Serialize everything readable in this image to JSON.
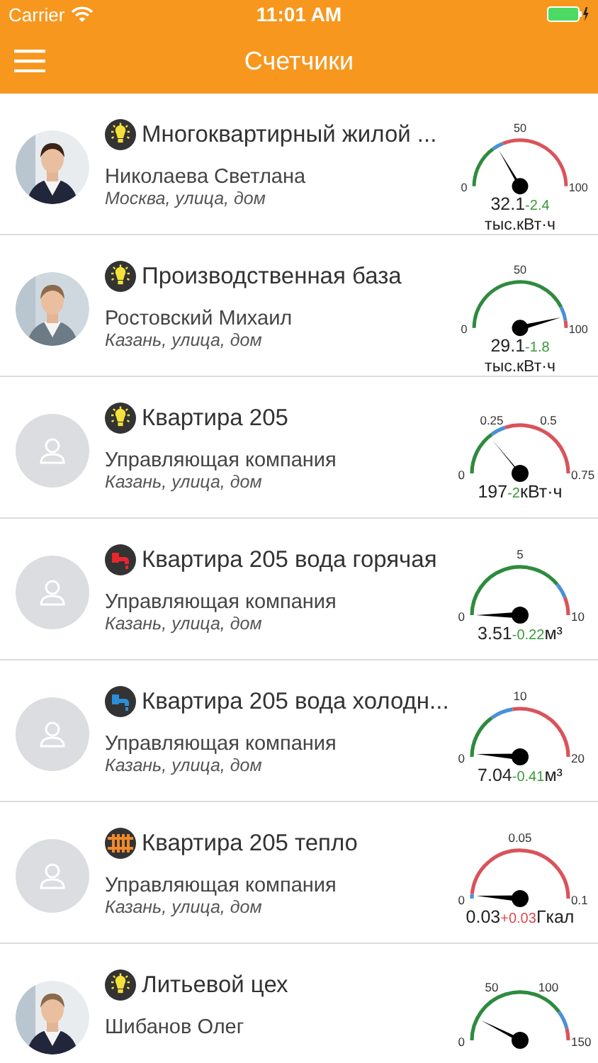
{
  "status_bar": {
    "carrier": "Carrier",
    "time": "11:01 AM"
  },
  "nav_bar": {
    "title": "Счетчики"
  },
  "meters": [
    {
      "icon": {
        "kind": "electricity"
      },
      "title": "Многоквартирный жилой ...",
      "owner": "Николаева Светлана",
      "address": "Москва, улица, дом",
      "gauge": {
        "ticks": [
          "0",
          "50",
          "100"
        ],
        "zones": [
          {
            "color": "#2e8b3e"
          },
          {
            "color": "#4a90d9"
          },
          {
            "color": "#d9535b"
          }
        ],
        "value": "32.1",
        "delta": {
          "text": "-2.4",
          "kind": "decrease"
        },
        "unit": "тыс.кВт·ч",
        "unit_on_new_line": true
      }
    },
    {
      "icon": {
        "kind": "electricity"
      },
      "title": "Производственная база",
      "owner": "Ростовский Михаил",
      "address": "Казань, улица, дом",
      "gauge": {
        "ticks": [
          "0",
          "50",
          "100"
        ],
        "zones": [
          {
            "color": "#2e8b3e"
          },
          {
            "color": "#4a90d9"
          },
          {
            "color": "#d9535b"
          }
        ],
        "value": "29.1",
        "delta": {
          "text": "-1.8",
          "kind": "decrease"
        },
        "unit": "тыс.кВт·ч",
        "unit_on_new_line": true
      }
    },
    {
      "avatar": {
        "kind": "placeholder"
      },
      "icon": {
        "kind": "electricity"
      },
      "title": "Квартира 205",
      "owner": "Управляющая компания",
      "address": "Казань, улица, дом",
      "gauge": {
        "ticks": [
          "0",
          "0.25",
          "0.5",
          "0.75"
        ],
        "zones": [
          {
            "color": "#2e8b3e"
          },
          {
            "color": "#4a90d9"
          },
          {
            "color": "#d9535b"
          }
        ],
        "value": "197",
        "delta": {
          "text": "-2",
          "kind": "decrease"
        },
        "unit": "кВт·ч",
        "unit_on_new_line": false
      }
    },
    {
      "avatar": {
        "kind": "placeholder"
      },
      "icon": {
        "kind": "hot_water"
      },
      "title": "Квартира 205 вода горячая",
      "owner": "Управляющая компания",
      "address": "Казань, улица, дом",
      "gauge": {
        "ticks": [
          "0",
          "5",
          "10"
        ],
        "zones": [
          {
            "color": "#2e8b3e"
          },
          {
            "color": "#4a90d9"
          },
          {
            "color": "#d9535b"
          }
        ],
        "value": "3.51",
        "delta": {
          "text": "-0.22",
          "kind": "decrease"
        },
        "unit": "м³",
        "unit_on_new_line": false
      }
    },
    {
      "avatar": {
        "kind": "placeholder"
      },
      "icon": {
        "kind": "cold_water"
      },
      "title": "Квартира 205 вода холодн...",
      "owner": "Управляющая компания",
      "address": "Казань, улица, дом",
      "gauge": {
        "ticks": [
          "0",
          "10",
          "20"
        ],
        "zones": [
          {
            "color": "#2e8b3e"
          },
          {
            "color": "#4a90d9"
          },
          {
            "color": "#d9535b"
          }
        ],
        "value": "7.04",
        "delta": {
          "text": "-0.41",
          "kind": "decrease"
        },
        "unit": "м³",
        "unit_on_new_line": false
      }
    },
    {
      "avatar": {
        "kind": "placeholder"
      },
      "icon": {
        "kind": "heat"
      },
      "title": "Квартира 205 тепло",
      "owner": "Управляющая компания",
      "address": "Казань, улица, дом",
      "gauge": {
        "ticks": [
          "0",
          "0.05",
          "0.1"
        ],
        "zones": [
          {
            "color": "#4a90d9"
          },
          {
            "color": "#d9535b"
          }
        ],
        "value": "0.03",
        "delta": {
          "text": "+0.03",
          "kind": "increase"
        },
        "unit": "Гкал",
        "unit_on_new_line": false
      }
    },
    {
      "icon": {
        "kind": "electricity"
      },
      "title": "Литьевой цех",
      "owner": "Шибанов Олег",
      "gauge": {
        "ticks": [
          "0",
          "50",
          "100",
          "150"
        ],
        "zones": [
          {
            "color": "#2e8b3e"
          },
          {
            "color": "#4a90d9"
          },
          {
            "color": "#d9535b"
          }
        ]
      }
    }
  ]
}
